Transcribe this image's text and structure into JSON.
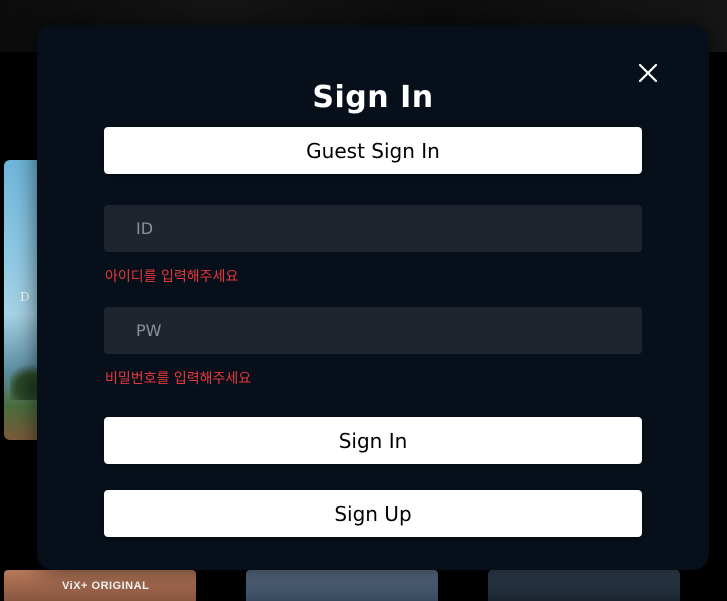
{
  "background": {
    "poster_left_text": "D e",
    "card_label": "ViX+ ORIGINAL"
  },
  "modal": {
    "title": "Sign In",
    "close_icon": "close-icon",
    "guest_button_label": "Guest Sign In",
    "id_field": {
      "placeholder": "ID",
      "value": "",
      "error": "아이디를 입력해주세요"
    },
    "pw_field": {
      "placeholder": "PW",
      "value": "",
      "error": "비밀번호를 입력해주세요"
    },
    "signin_button_label": "Sign In",
    "signup_button_label": "Sign Up"
  },
  "colors": {
    "modal_bg": "#07101a",
    "field_bg": "#1f252f",
    "error": "#e5383b",
    "button_bg": "#ffffff"
  }
}
